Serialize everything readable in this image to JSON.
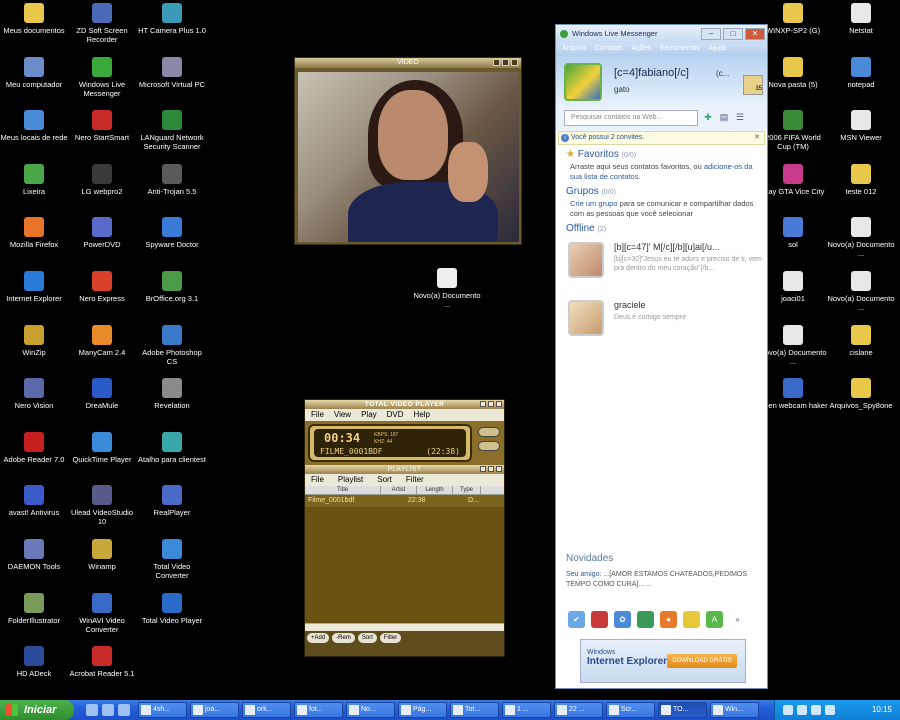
{
  "desktop_icons_col1": [
    {
      "label": "Meus documentos",
      "icon": "folder-icon",
      "color": "#e8c84a"
    },
    {
      "label": "Meu computador",
      "icon": "computer-icon",
      "color": "#6a8cc8"
    },
    {
      "label": "Meus locais de rede",
      "icon": "network-icon",
      "color": "#4a8ad8"
    },
    {
      "label": "Lixeira",
      "icon": "recycle-bin-icon",
      "color": "#4aa84a"
    },
    {
      "label": "Mozilla Firefox",
      "icon": "firefox-icon",
      "color": "#e8742a"
    },
    {
      "label": "Internet Explorer",
      "icon": "ie-icon",
      "color": "#2a7ad8"
    },
    {
      "label": "WinZip",
      "icon": "winzip-icon",
      "color": "#c8a030"
    },
    {
      "label": "Nero Vision",
      "icon": "nero-vision-icon",
      "color": "#5a6aa8"
    },
    {
      "label": "Adobe Reader 7.0",
      "icon": "adobe-reader-icon",
      "color": "#c82020"
    },
    {
      "label": "avast! Antivirus",
      "icon": "avast-icon",
      "color": "#3a5ac8"
    },
    {
      "label": "DAEMON Tools",
      "icon": "daemon-tools-icon",
      "color": "#6a7ab8"
    },
    {
      "label": "FolderIllustrator",
      "icon": "folder-illustrator-icon",
      "color": "#7a9a5a"
    },
    {
      "label": "HD ADeck",
      "icon": "hd-adeck-icon",
      "color": "#2a4a9a"
    }
  ],
  "desktop_icons_col2": [
    {
      "label": "ZD Soft Screen Recorder",
      "icon": "screen-recorder-icon",
      "color": "#4a6ab8"
    },
    {
      "label": "Windows Live Messenger",
      "icon": "messenger-icon",
      "color": "#3aa83a"
    },
    {
      "label": "Nero StartSmart",
      "icon": "nero-icon",
      "color": "#c82a2a"
    },
    {
      "label": "LG webpro2",
      "icon": "webcam-icon",
      "color": "#3a3a3a"
    },
    {
      "label": "PowerDVD",
      "icon": "powerdvd-icon",
      "color": "#5a6ac8"
    },
    {
      "label": "Nero Express",
      "icon": "nero-express-icon",
      "color": "#d8402a"
    },
    {
      "label": "ManyCam 2.4",
      "icon": "manycam-icon",
      "color": "#e88a2a"
    },
    {
      "label": "DreaMule",
      "icon": "dreamule-icon",
      "color": "#2a5ac8"
    },
    {
      "label": "QuickTime Player",
      "icon": "quicktime-icon",
      "color": "#3a8ad8"
    },
    {
      "label": "Ulead VideoStudio 10",
      "icon": "videostudio-icon",
      "color": "#5a5a8a"
    },
    {
      "label": "Winamp",
      "icon": "winamp-icon",
      "color": "#c8a83a"
    },
    {
      "label": "WinAVI Video Converter",
      "icon": "winavi-icon",
      "color": "#3a6ac8"
    },
    {
      "label": "Acrobat Reader 5.1",
      "icon": "acrobat-icon",
      "color": "#c82a2a"
    }
  ],
  "desktop_icons_col3": [
    {
      "label": "HT Camera Plus 1.0",
      "icon": "camera-icon",
      "color": "#3a9ab8"
    },
    {
      "label": "Microsoft Virtual PC",
      "icon": "virtual-pc-icon",
      "color": "#8a8aa8"
    },
    {
      "label": "LANguard Network Security Scanner",
      "icon": "languard-icon",
      "color": "#2a8a3a"
    },
    {
      "label": "Anti-Trojan 5.5",
      "icon": "anti-trojan-icon",
      "color": "#5a5a5a"
    },
    {
      "label": "Spyware Doctor",
      "icon": "spyware-doctor-icon",
      "color": "#3a7ad8"
    },
    {
      "label": "BrOffice.org 3.1",
      "icon": "broffice-icon",
      "color": "#4a9a4a"
    },
    {
      "label": "Adobe Photoshop CS",
      "icon": "photoshop-icon",
      "color": "#3a7ac8"
    },
    {
      "label": "Revelation",
      "icon": "revelation-icon",
      "color": "#8a8a8a"
    },
    {
      "label": "Atalho para clientest",
      "icon": "shortcut-icon",
      "color": "#3aa8a8"
    },
    {
      "label": "RealPlayer",
      "icon": "realplayer-icon",
      "color": "#4a6ac8"
    },
    {
      "label": "Total Video Converter",
      "icon": "video-converter-icon",
      "color": "#3a8ad8"
    },
    {
      "label": "Total Video Player",
      "icon": "video-player-icon",
      "color": "#2a6ac8"
    }
  ],
  "desktop_icons_right1": [
    {
      "label": "WINXP-SP2 (G)",
      "icon": "folder-icon",
      "color": "#e8c84a"
    },
    {
      "label": "Nova pasta (5)",
      "icon": "folder-icon",
      "color": "#e8c84a"
    },
    {
      "label": "2006 FIFA World Cup (TM)",
      "icon": "fifa-icon",
      "color": "#3a8a3a"
    },
    {
      "label": "Play GTA Vice City",
      "icon": "gta-icon",
      "color": "#c83a8a"
    },
    {
      "label": "sol",
      "icon": "file-icon",
      "color": "#4a7ad8"
    },
    {
      "label": "joaci01",
      "icon": "document-icon",
      "color": "#e8e8e8"
    },
    {
      "label": "Novo(a) Documento ...",
      "icon": "document-icon",
      "color": "#e8e8e8"
    },
    {
      "label": "Open webcam haker",
      "icon": "flag-icon",
      "color": "#3a6ac8"
    }
  ],
  "desktop_icons_right2": [
    {
      "label": "Netstat",
      "icon": "document-icon",
      "color": "#e8e8e8"
    },
    {
      "label": "notepad",
      "icon": "notepad-icon",
      "color": "#4a8ad8"
    },
    {
      "label": "MSN Viewer",
      "icon": "document-icon",
      "color": "#e8e8e8"
    },
    {
      "label": "teste 012",
      "icon": "folder-icon",
      "color": "#e8c84a"
    },
    {
      "label": "Novo(a) Documento ...",
      "icon": "document-icon",
      "color": "#e8e8e8"
    },
    {
      "label": "Novo(a) Documento ...",
      "icon": "document-icon",
      "color": "#e8e8e8"
    },
    {
      "label": "cislane",
      "icon": "folder-icon",
      "color": "#e8c84a"
    },
    {
      "label": "Arquivos_Spy8one",
      "icon": "folder-icon",
      "color": "#e8c84a"
    }
  ],
  "desktop_icon_center": {
    "label": "Novo(a) Documento ...",
    "icon": "document-icon"
  },
  "video_window": {
    "title": "VIDEO"
  },
  "player": {
    "title": "TOTAL VIDEO PLAYER",
    "menu": [
      "File",
      "View",
      "Play",
      "DVD",
      "Help"
    ],
    "time": "00:34",
    "kbps": "KBPS: 187",
    "khz": "KHZ: 44",
    "file_name": "FILME_0001BDF",
    "duration": "(22:38)",
    "playlist_title": "PLAYLIST",
    "playlist_menu": [
      "File",
      "Playlist",
      "Sort",
      "Filter"
    ],
    "playlist_columns": [
      "Title",
      "Artist",
      "Length",
      "Type"
    ],
    "playlist_rows": [
      {
        "title": "Filme_0001bdf",
        "length": "22:38",
        "type": "D..."
      }
    ],
    "buttons": [
      "+Add",
      "-Rem",
      "Sort",
      "Filter"
    ]
  },
  "messenger": {
    "title": "Windows Live Messenger",
    "menu": [
      "Arquivo",
      "Contatos",
      "Ações",
      "Ferramentas",
      "Ajuda"
    ],
    "username": "[c=4]fabiano[/c]",
    "username_extra": "(c...",
    "status": "gato",
    "mail_count": "35",
    "search_placeholder": "Pesquisar contatos na Web...",
    "invite_text": "Você possui 2 convites.",
    "favorites_title": "Favoritos",
    "favorites_count": "(0/0)",
    "favorites_text_1": "Arraste aqui seus contatos favoritos, ou ",
    "favorites_link": "adicione-os da sua lista de contatos",
    "favorites_text_2": ".",
    "groups_title": "Grupos",
    "groups_count": "(0/0)",
    "groups_link": "Crie um grupo",
    "groups_text": " para se comunicar e compartilhar dados com as pessoas que você selecionar",
    "offline_title": "Offline",
    "offline_count": "(2)",
    "contacts": [
      {
        "name": "[b][c=47]' M[/c][/b][u]ai[/u...",
        "message": "[b][c=30]\"Jesus eu te adoro e preciso de ti, vem pra dentro do meu coração\"[/b..."
      },
      {
        "name": "graciele",
        "message": "Deus é comigo sempre"
      }
    ],
    "news_title": "Novidades",
    "news_link": "Seu amigo:",
    "news_text": " ...[AMOR ESTAMOS CHATEADOS,PEDIMOS TEMPO COMO CURA]... ...",
    "ad_brand_small": "Windows",
    "ad_brand": "Internet Explorer 8",
    "ad_button": "DOWNLOAD GRÁTIS"
  },
  "taskbar": {
    "start_label": "Iniciar",
    "tasks": [
      "4sh...",
      "joa...",
      "ork...",
      "fot...",
      "No...",
      "Pág...",
      "Tot...",
      "1 ...",
      "22 ...",
      "Scr...",
      "TO...",
      "Win..."
    ],
    "clock": "10:15"
  }
}
